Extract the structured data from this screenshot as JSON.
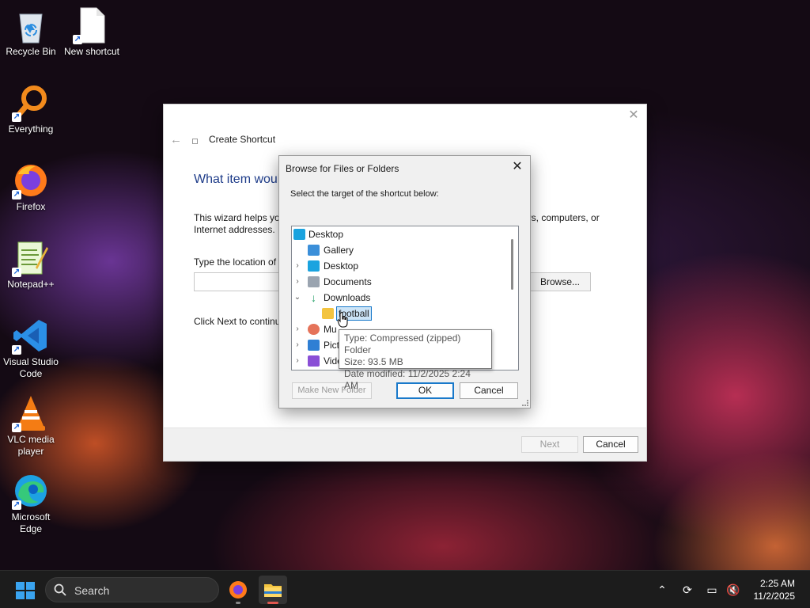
{
  "desktop": {
    "icons": [
      {
        "label": "Recycle Bin",
        "icon": "recycle-bin-icon"
      },
      {
        "label": "New shortcut",
        "icon": "blank-file-icon"
      },
      {
        "label": "Everything",
        "icon": "everything-search-icon"
      },
      {
        "label": "Firefox",
        "icon": "firefox-icon"
      },
      {
        "label": "Notepad++",
        "icon": "notepadpp-icon"
      },
      {
        "label": "Visual Studio Code",
        "icon": "vscode-icon"
      },
      {
        "label": "VLC media player",
        "icon": "vlc-icon"
      },
      {
        "label": "Microsoft Edge",
        "icon": "edge-icon"
      }
    ]
  },
  "wizard": {
    "title": "Create Shortcut",
    "heading": "What item woul",
    "description": "This wizard helps you                                                                                          ers, computers, or Internet addresses.",
    "desc_line1_left": "This wizard helps you",
    "desc_line1_right": "ers, computers, or",
    "desc_line2": "Internet addresses.",
    "location_label": "Type the location of t",
    "location_value": "",
    "browse_label": "Browse...",
    "next_note": "Click Next to continu",
    "next_label": "Next",
    "cancel_label": "Cancel"
  },
  "browse_dialog": {
    "title": "Browse for Files or Folders",
    "prompt": "Select the target of the shortcut below:",
    "tree": [
      {
        "label": "Desktop",
        "icon": "desktop-icon",
        "expanded": true,
        "level": 0
      },
      {
        "label": "Gallery",
        "icon": "gallery-icon",
        "level": 1
      },
      {
        "label": "Desktop",
        "icon": "desktop-icon",
        "level": 1,
        "chevron": "›"
      },
      {
        "label": "Documents",
        "icon": "documents-icon",
        "level": 1,
        "chevron": "›"
      },
      {
        "label": "Downloads",
        "icon": "download-icon",
        "level": 1,
        "chevron": "⌄"
      },
      {
        "label": "football",
        "icon": "zip-folder-icon",
        "level": 2,
        "selected": true
      },
      {
        "label": "Mu",
        "icon": "music-icon",
        "level": 1,
        "chevron": "›"
      },
      {
        "label": "Pict",
        "icon": "pictures-icon",
        "level": 1,
        "chevron": "›"
      },
      {
        "label": "Vide",
        "icon": "videos-icon",
        "level": 1,
        "chevron": "›"
      }
    ],
    "tooltip": {
      "type": "Type: Compressed (zipped) Folder",
      "size": "Size: 93.5 MB",
      "modified": "Date modified: 11/2/2025 2:24 AM"
    },
    "new_folder_label": "Make New Folder",
    "ok_label": "OK",
    "cancel_label": "Cancel"
  },
  "taskbar": {
    "search_label": "Search",
    "apps": [
      "firefox-icon",
      "file-explorer-icon"
    ],
    "time": "2:25 AM",
    "date": "11/2/2025"
  },
  "colors": {
    "accent": "#1979ca",
    "heading": "#1f3d8a",
    "selection": "#cce4f7"
  }
}
